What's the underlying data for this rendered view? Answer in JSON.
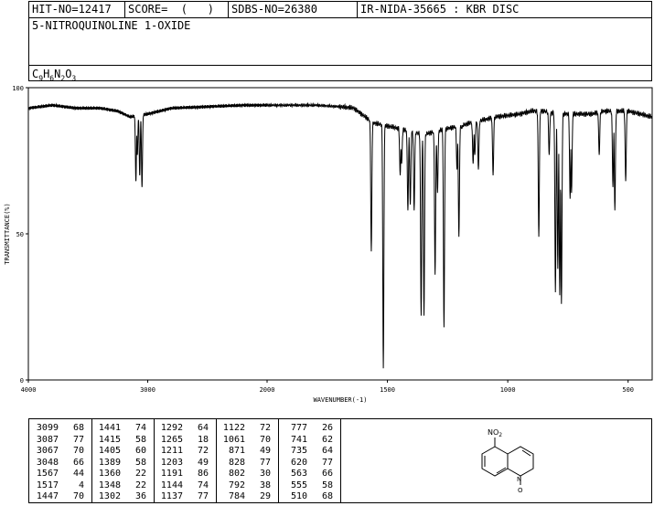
{
  "header": {
    "hit_no": "HIT-NO=12417",
    "score": "SCORE=  (   )",
    "sdbs_no": "SDBS-NO=26380",
    "ir_no": "IR-NIDA-35665 : KBR DISC",
    "compound_name": "5-NITROQUINOLINE 1-OXIDE",
    "formula_parts": [
      {
        "t": "C",
        "sub": "9"
      },
      {
        "t": "H",
        "sub": "6"
      },
      {
        "t": "N",
        "sub": "2"
      },
      {
        "t": "O",
        "sub": "3"
      }
    ]
  },
  "chart_data": {
    "type": "line",
    "title": "",
    "xlabel": "WAVENUMBER(-1)",
    "ylabel": "TRANSMITTANCE(%)",
    "xlim": [
      4000,
      400
    ],
    "ylim": [
      0,
      100
    ],
    "x_ticks": [
      4000,
      3000,
      2000,
      1500,
      1000,
      500
    ],
    "y_ticks": [
      0,
      50,
      100
    ],
    "baseline": [
      [
        4000,
        93
      ],
      [
        3800,
        94
      ],
      [
        3600,
        93
      ],
      [
        3400,
        93
      ],
      [
        3250,
        92
      ],
      [
        3150,
        90
      ],
      [
        3000,
        91
      ],
      [
        2900,
        92
      ],
      [
        2800,
        93
      ],
      [
        2500,
        93.5
      ],
      [
        2200,
        94
      ],
      [
        2000,
        94
      ],
      [
        1800,
        94
      ],
      [
        1700,
        93.5
      ],
      [
        1640,
        93
      ],
      [
        1560,
        88
      ],
      [
        1450,
        86
      ],
      [
        1350,
        84
      ],
      [
        1250,
        86
      ],
      [
        1150,
        88
      ],
      [
        1050,
        90
      ],
      [
        950,
        91
      ],
      [
        900,
        92
      ],
      [
        850,
        92
      ],
      [
        800,
        91
      ],
      [
        750,
        91
      ],
      [
        700,
        91
      ],
      [
        650,
        91
      ],
      [
        600,
        92
      ],
      [
        550,
        92
      ],
      [
        500,
        92
      ],
      [
        450,
        91
      ],
      [
        400,
        90
      ]
    ],
    "peaks": [
      {
        "wavenumber": 3099,
        "transmittance": 68
      },
      {
        "wavenumber": 3087,
        "transmittance": 77
      },
      {
        "wavenumber": 3067,
        "transmittance": 70
      },
      {
        "wavenumber": 3048,
        "transmittance": 66
      },
      {
        "wavenumber": 1567,
        "transmittance": 44
      },
      {
        "wavenumber": 1517,
        "transmittance": 4
      },
      {
        "wavenumber": 1447,
        "transmittance": 70
      },
      {
        "wavenumber": 1441,
        "transmittance": 74
      },
      {
        "wavenumber": 1415,
        "transmittance": 58
      },
      {
        "wavenumber": 1405,
        "transmittance": 60
      },
      {
        "wavenumber": 1389,
        "transmittance": 58
      },
      {
        "wavenumber": 1360,
        "transmittance": 22
      },
      {
        "wavenumber": 1348,
        "transmittance": 22
      },
      {
        "wavenumber": 1302,
        "transmittance": 36
      },
      {
        "wavenumber": 1292,
        "transmittance": 64
      },
      {
        "wavenumber": 1265,
        "transmittance": 18
      },
      {
        "wavenumber": 1211,
        "transmittance": 72
      },
      {
        "wavenumber": 1203,
        "transmittance": 49
      },
      {
        "wavenumber": 1191,
        "transmittance": 86
      },
      {
        "wavenumber": 1144,
        "transmittance": 74
      },
      {
        "wavenumber": 1137,
        "transmittance": 77
      },
      {
        "wavenumber": 1122,
        "transmittance": 72
      },
      {
        "wavenumber": 1061,
        "transmittance": 70
      },
      {
        "wavenumber": 871,
        "transmittance": 49
      },
      {
        "wavenumber": 828,
        "transmittance": 77
      },
      {
        "wavenumber": 802,
        "transmittance": 30
      },
      {
        "wavenumber": 792,
        "transmittance": 38
      },
      {
        "wavenumber": 784,
        "transmittance": 29
      },
      {
        "wavenumber": 777,
        "transmittance": 26
      },
      {
        "wavenumber": 741,
        "transmittance": 62
      },
      {
        "wavenumber": 735,
        "transmittance": 64
      },
      {
        "wavenumber": 620,
        "transmittance": 77
      },
      {
        "wavenumber": 563,
        "transmittance": 66
      },
      {
        "wavenumber": 555,
        "transmittance": 58
      },
      {
        "wavenumber": 510,
        "transmittance": 68
      }
    ]
  },
  "peak_table": {
    "columns": [
      [
        [
          "3099",
          "68"
        ],
        [
          "3087",
          "77"
        ],
        [
          "3067",
          "70"
        ],
        [
          "3048",
          "66"
        ],
        [
          "1567",
          "44"
        ],
        [
          "1517",
          "4"
        ],
        [
          "1447",
          "70"
        ]
      ],
      [
        [
          "1441",
          "74"
        ],
        [
          "1415",
          "58"
        ],
        [
          "1405",
          "60"
        ],
        [
          "1389",
          "58"
        ],
        [
          "1360",
          "22"
        ],
        [
          "1348",
          "22"
        ],
        [
          "1302",
          "36"
        ]
      ],
      [
        [
          "1292",
          "64"
        ],
        [
          "1265",
          "18"
        ],
        [
          "1211",
          "72"
        ],
        [
          "1203",
          "49"
        ],
        [
          "1191",
          "86"
        ],
        [
          "1144",
          "74"
        ],
        [
          "1137",
          "77"
        ]
      ],
      [
        [
          "1122",
          "72"
        ],
        [
          "1061",
          "70"
        ],
        [
          "871",
          "49"
        ],
        [
          "828",
          "77"
        ],
        [
          "802",
          "30"
        ],
        [
          "792",
          "38"
        ],
        [
          "784",
          "29"
        ]
      ],
      [
        [
          "777",
          "26"
        ],
        [
          "741",
          "62"
        ],
        [
          "735",
          "64"
        ],
        [
          "620",
          "77"
        ],
        [
          "563",
          "66"
        ],
        [
          "555",
          "58"
        ],
        [
          "510",
          "68"
        ]
      ]
    ]
  },
  "structure": {
    "substituent_label": "NO",
    "substituent_sub": "2",
    "ring_n": "N",
    "oxide_o": "O"
  }
}
